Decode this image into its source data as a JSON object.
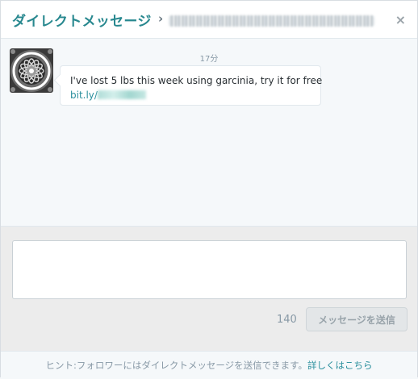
{
  "header": {
    "title": "ダイレクトメッセージ",
    "separator": "›",
    "close_icon": "×"
  },
  "thread": {
    "timestamp": "17分",
    "message": {
      "text": "I've lost 5 lbs this week using garcinia, try it for free",
      "link_prefix": "bit.ly/"
    }
  },
  "compose": {
    "textarea_value": "",
    "char_count": "140",
    "send_label": "メッセージを送信"
  },
  "footer": {
    "hint": "ヒント:フォロワーにはダイレクトメッセージを送信できます。",
    "more_link": "詳しくはこちら"
  },
  "colors": {
    "accent": "#28888f",
    "link": "#2a8f9d",
    "muted": "#8899a6"
  }
}
